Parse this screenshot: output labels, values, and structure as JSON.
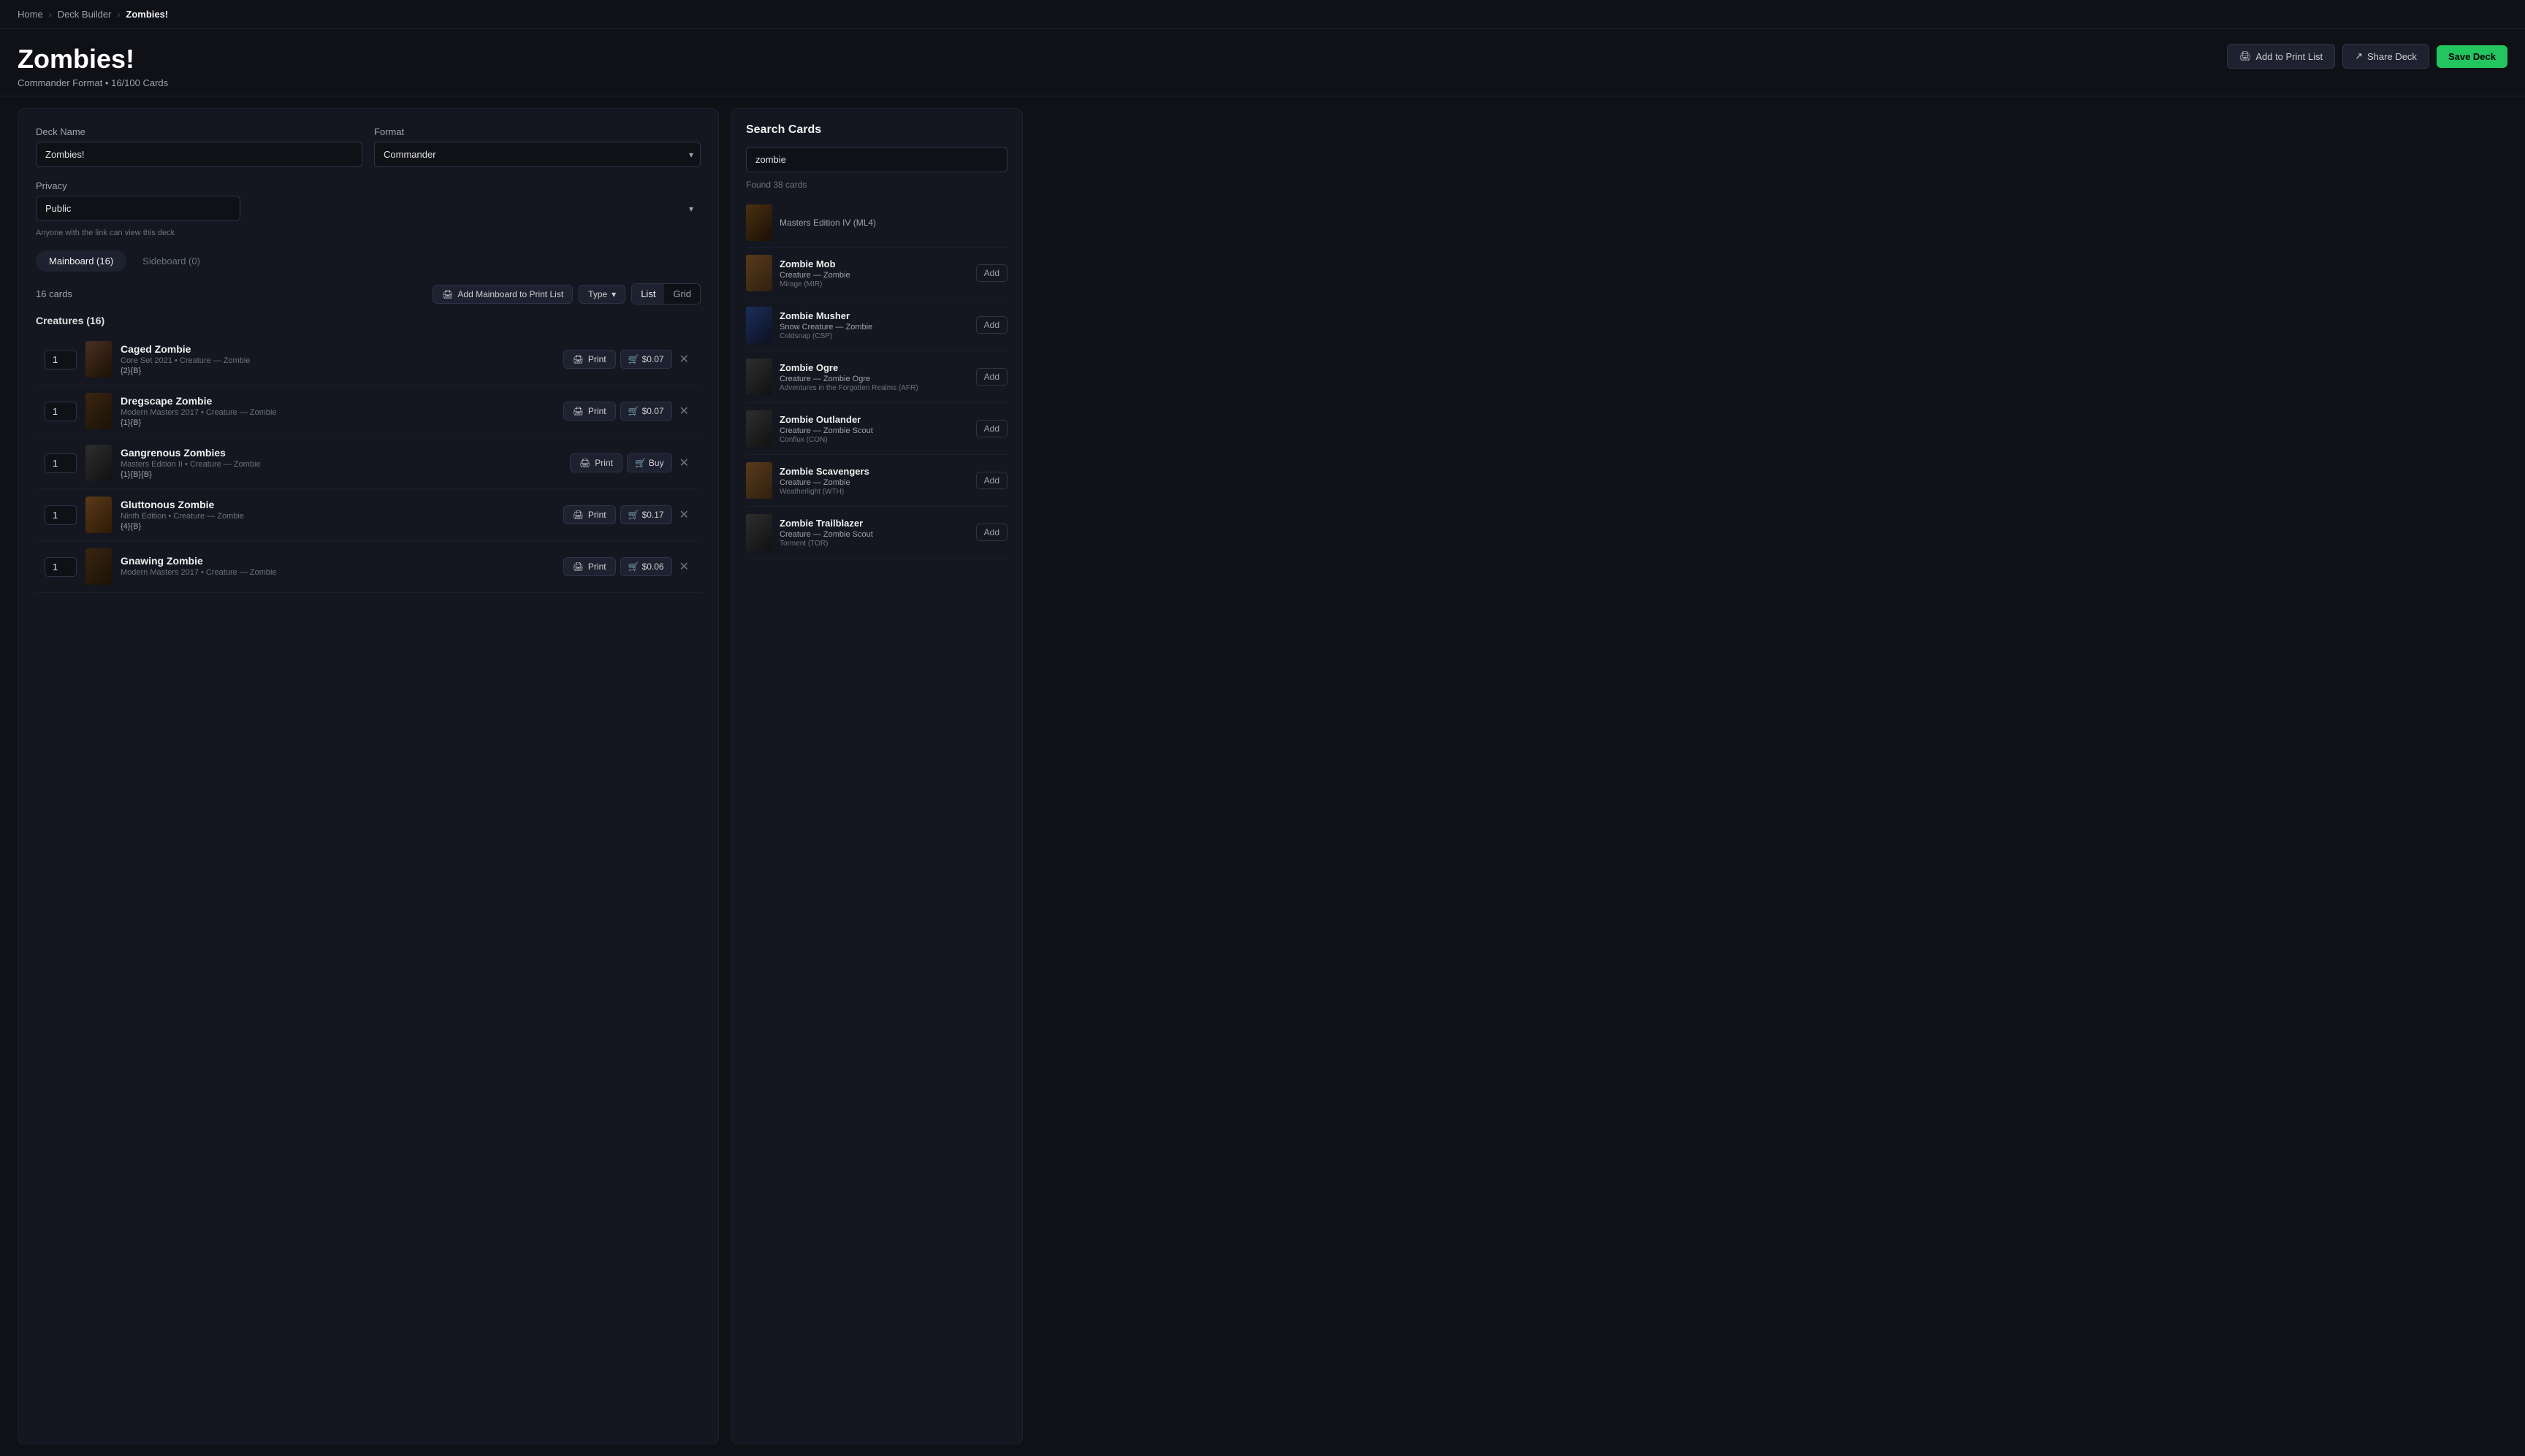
{
  "nav": {
    "crumbs": [
      "Home",
      "Deck Builder",
      "Zombies!"
    ]
  },
  "page": {
    "title": "Zombies!",
    "subtitle": "Commander Format • 16/100 Cards"
  },
  "header_buttons": {
    "print_list": "Add to Print List",
    "share_deck": "Share Deck",
    "save_deck": "Save Deck"
  },
  "deck_form": {
    "deck_name_label": "Deck Name",
    "deck_name_value": "Zombies!",
    "format_label": "Format",
    "format_value": "Commander",
    "privacy_label": "Privacy",
    "privacy_value": "Public",
    "privacy_hint": "Anyone with the link can view this deck"
  },
  "tabs": [
    {
      "label": "Mainboard (16)",
      "count": 16,
      "active": true
    },
    {
      "label": "Sideboard (0)",
      "count": 0,
      "active": false
    }
  ],
  "card_list": {
    "count_text": "16 cards",
    "add_to_print_label": "Add Mainboard to Print List",
    "type_filter": "Type",
    "view_list": "List",
    "view_grid": "Grid",
    "section_title": "Creatures (16)",
    "cards": [
      {
        "qty": 1,
        "name": "Caged Zombie",
        "set": "Core Set 2021",
        "type": "Creature — Zombie",
        "cost": "{2}{B}",
        "print_label": "Print",
        "price": "$0.07",
        "thumb_color": "brown"
      },
      {
        "qty": 1,
        "name": "Dregscape Zombie",
        "set": "Modern Masters 2017",
        "type": "Creature — Zombie",
        "cost": "{1}{B}",
        "print_label": "Print",
        "price": "$0.07",
        "thumb_color": "brown"
      },
      {
        "qty": 1,
        "name": "Gangrenous Zombies",
        "set": "Masters Edition II",
        "type": "Creature — Zombie",
        "cost": "{1}{B}{B}",
        "print_label": "Print",
        "buy_label": "Buy",
        "price": null,
        "thumb_color": "dark"
      },
      {
        "qty": 1,
        "name": "Gluttonous Zombie",
        "set": "Ninth Edition",
        "type": "Creature — Zombie",
        "cost": "{4}{B}",
        "print_label": "Print",
        "price": "$0.17",
        "thumb_color": "brown"
      },
      {
        "qty": 1,
        "name": "Gnawing Zombie",
        "set": "Modern Masters 2017",
        "type": "Creature — Zombie",
        "cost": "",
        "print_label": "Print",
        "price": "$0.06",
        "thumb_color": "brown"
      }
    ]
  },
  "search": {
    "title": "Search Cards",
    "placeholder": "zombie",
    "found_count": "Found 38 cards",
    "results": [
      {
        "name": "Masters Edition IV (ML4)",
        "type": "",
        "set": "",
        "is_separator": true,
        "thumb_color": "brown"
      },
      {
        "name": "Zombie Mob",
        "type": "Creature — Zombie",
        "set": "Mirage (MIR)",
        "is_separator": false,
        "thumb_color": "brown"
      },
      {
        "name": "Zombie Musher",
        "type": "Snow Creature — Zombie",
        "set": "Coldsnap (CSP)",
        "is_separator": false,
        "thumb_color": "blue"
      },
      {
        "name": "Zombie Ogre",
        "type": "Creature — Zombie Ogre",
        "set": "Adventures in the Forgotten Realms (AFR)",
        "is_separator": false,
        "thumb_color": "dark"
      },
      {
        "name": "Zombie Outlander",
        "type": "Creature — Zombie Scout",
        "set": "Conflux (CON)",
        "is_separator": false,
        "thumb_color": "dark"
      },
      {
        "name": "Zombie Scavengers",
        "type": "Creature — Zombie",
        "set": "Weatherlight (WTH)",
        "is_separator": false,
        "thumb_color": "brown"
      },
      {
        "name": "Zombie Trailblazer",
        "type": "Creature — Zombie Scout",
        "set": "Torment (TOR)",
        "is_separator": false,
        "thumb_color": "dark"
      }
    ],
    "add_label": "Add"
  }
}
